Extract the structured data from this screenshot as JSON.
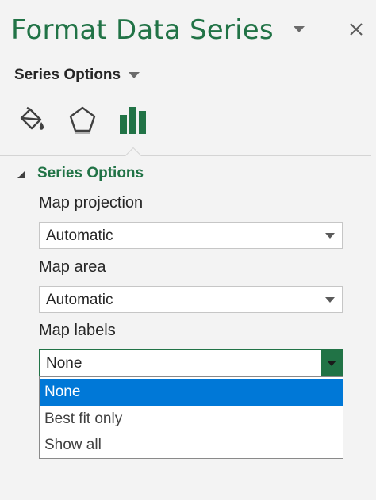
{
  "pane": {
    "title": "Format Data Series"
  },
  "options_selector": {
    "label": "Series Options"
  },
  "tabs": [
    {
      "icon": "paint-bucket-icon"
    },
    {
      "icon": "pentagon-icon"
    },
    {
      "icon": "bar-chart-icon",
      "active": true
    }
  ],
  "section": {
    "header": "Series Options",
    "fields": {
      "map_projection": {
        "label": "Map projection",
        "value": "Automatic"
      },
      "map_area": {
        "label": "Map area",
        "value": "Automatic"
      },
      "map_labels": {
        "label": "Map labels",
        "value": "None",
        "options": [
          "None",
          "Best fit only",
          "Show all"
        ]
      }
    }
  },
  "colors": {
    "accent_green": "#217346",
    "selection_blue": "#0078d7"
  }
}
